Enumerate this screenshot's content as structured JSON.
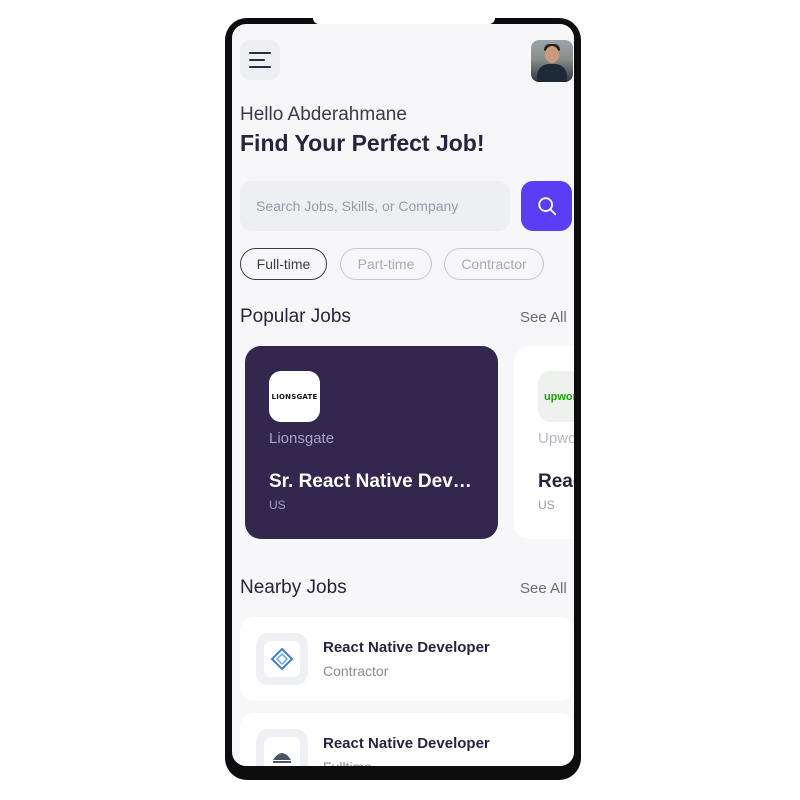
{
  "header": {
    "menu_icon": "hamburger-menu-icon",
    "avatar": "user-avatar"
  },
  "greeting": {
    "hello": "Hello Abderahmane",
    "headline": "Find Your Perfect Job!"
  },
  "search": {
    "placeholder": "Search Jobs, Skills, or Company",
    "button_icon": "search-icon"
  },
  "filters": [
    {
      "label": "Full-time",
      "active": true
    },
    {
      "label": "Part-time",
      "active": false
    },
    {
      "label": "Contractor",
      "active": false
    }
  ],
  "popular": {
    "title": "Popular Jobs",
    "see_all": "See All",
    "cards": [
      {
        "logo_text": "LIONSGATE",
        "company": "Lionsgate",
        "role": "Sr. React Native Developer",
        "location": "US"
      },
      {
        "logo_text": "upwork",
        "company": "Upwork",
        "role": "React Native Developer",
        "location": "US"
      }
    ]
  },
  "nearby": {
    "title": "Nearby Jobs",
    "see_all": "See All",
    "items": [
      {
        "role": "React Native Developer",
        "type": "Contractor"
      },
      {
        "role": "React Native Developer",
        "type": "Fulltime"
      }
    ]
  },
  "colors": {
    "accent": "#5b3df5",
    "card_dark": "#33264f",
    "text_dark": "#26253f"
  }
}
